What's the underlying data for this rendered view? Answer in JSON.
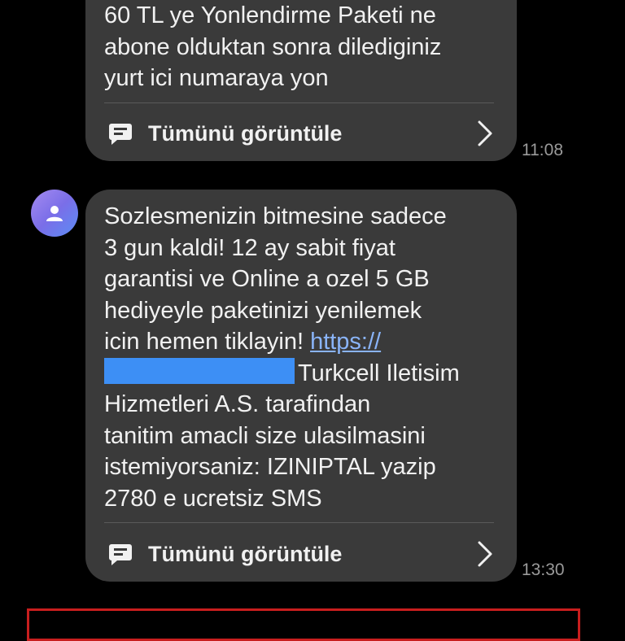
{
  "messages": [
    {
      "lines": [
        "60 TL ye Yonlendirme Paketi ne",
        "abone olduktan sonra dilediginiz",
        "yurt ici numaraya yon"
      ],
      "view_all_label": "Tümünü görüntüle",
      "time": "11:08"
    },
    {
      "lines": [
        "Sozlesmenizin bitmesine sadece",
        "3 gun kaldi! 12 ay sabit fiyat",
        "garantisi ve Online a ozel 5 GB",
        "hediyeyle paketinizi yenilemek"
      ],
      "line5_prefix": "icin hemen tiklayin!",
      "link_text": "https://",
      "line6_suffix": "Turkcell Iletisim",
      "lines_after": [
        "Hizmetleri A.S. tarafindan",
        "tanitim amacli size ulasilmasini",
        "istemiyorsaniz: IZINIPTAL yazip",
        "2780 e ucretsiz SMS"
      ],
      "view_all_label": "Tümünü görüntüle",
      "time": "13:30"
    }
  ],
  "icons": {
    "avatar": "person-icon",
    "view_all": "message-icon",
    "expand": "chevron-right-icon"
  },
  "colors": {
    "background": "#000000",
    "bubble": "#3a3a3a",
    "text": "#f1f1f1",
    "link": "#8ab4f8",
    "timestamp": "#9a9a9a",
    "redaction": "#3d8ff5",
    "highlight_border": "#c81e1e"
  }
}
